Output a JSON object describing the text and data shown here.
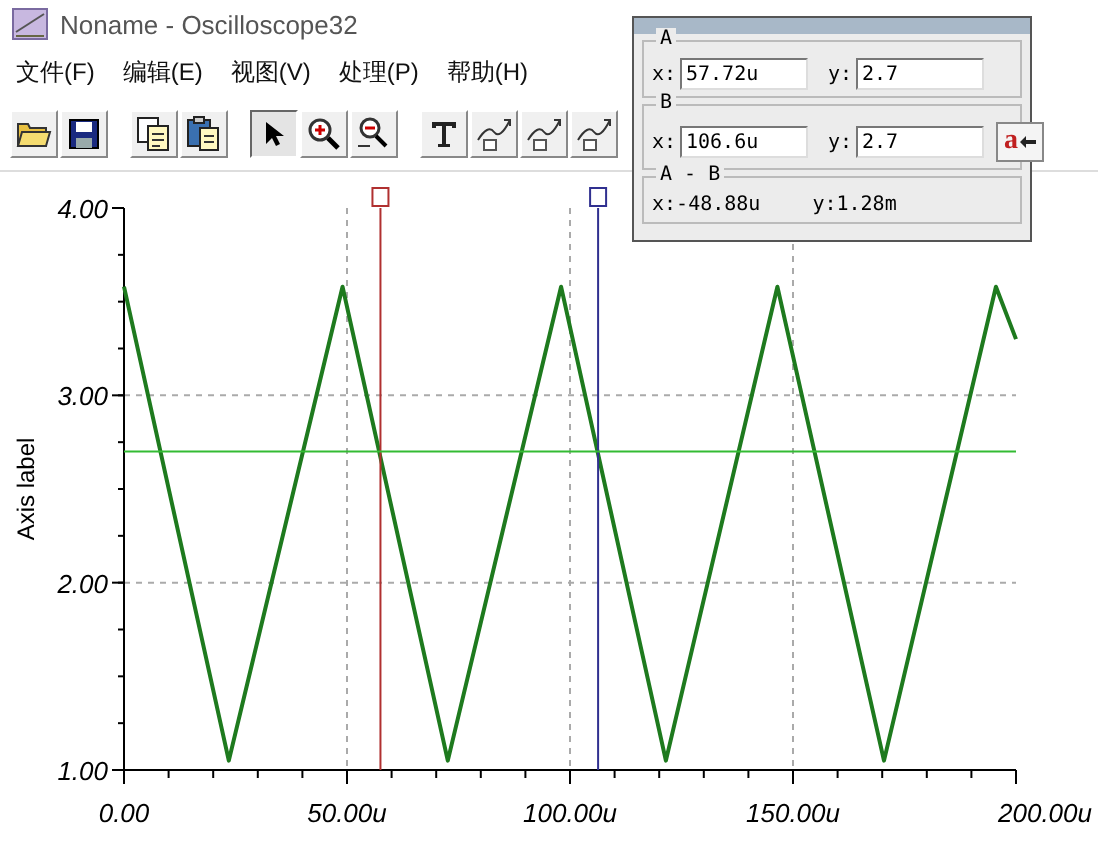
{
  "window": {
    "title": "Noname - Oscilloscope32"
  },
  "menu": [
    {
      "label": "文件(F)"
    },
    {
      "label": "编辑(E)"
    },
    {
      "label": "视图(V)"
    },
    {
      "label": "处理(P)"
    },
    {
      "label": "帮助(H)"
    }
  ],
  "toolbar": [
    {
      "kind": "open",
      "selected": false
    },
    {
      "kind": "save",
      "selected": false
    },
    {
      "kind": "gap"
    },
    {
      "kind": "copy",
      "selected": false
    },
    {
      "kind": "paste",
      "selected": false
    },
    {
      "kind": "gap"
    },
    {
      "kind": "pointer",
      "selected": true
    },
    {
      "kind": "zoom_in",
      "selected": false
    },
    {
      "kind": "zoom_out",
      "selected": false
    },
    {
      "kind": "gap"
    },
    {
      "kind": "text",
      "selected": false
    },
    {
      "kind": "curve",
      "selected": false
    },
    {
      "kind": "curve",
      "selected": false
    },
    {
      "kind": "curve",
      "selected": false
    }
  ],
  "chart_data": {
    "type": "line",
    "ylabel": "Axis label",
    "xlim": [
      0,
      200
    ],
    "ylim": [
      1,
      4
    ],
    "xticks": [
      {
        "value": 0,
        "label": "0.00"
      },
      {
        "value": 50,
        "label": "50.00u"
      },
      {
        "value": 100,
        "label": "100.00u"
      },
      {
        "value": 150,
        "label": "150.00u"
      },
      {
        "value": 200,
        "label": "200.00u"
      }
    ],
    "yticks": [
      {
        "value": 1,
        "label": "1.00"
      },
      {
        "value": 2,
        "label": "2.00"
      },
      {
        "value": 3,
        "label": "3.00"
      },
      {
        "value": 4,
        "label": "4.00"
      }
    ],
    "x": [
      0,
      23.5,
      49,
      72.6,
      98,
      121.5,
      146.5,
      170.4,
      195.5,
      200
    ],
    "grid": true,
    "series": [
      {
        "color": "#1e7a1e",
        "values": [
          3.58,
          1.05,
          3.58,
          1.05,
          3.58,
          1.05,
          3.58,
          1.05,
          3.58,
          3.3
        ]
      }
    ],
    "ref_lines": [
      {
        "axis": "x",
        "value": 57.5,
        "color": "#b03030"
      },
      {
        "axis": "x",
        "value": 106.3,
        "color": "#303090"
      },
      {
        "axis": "y",
        "value": 2.7,
        "color": "#33bb33"
      }
    ]
  },
  "cursor_panel": {
    "groups": [
      {
        "title": "A",
        "fields": [
          {
            "label": "x:",
            "value": "57.72u"
          },
          {
            "label": "y:",
            "value": "2.7"
          }
        ]
      },
      {
        "title": "B",
        "fields": [
          {
            "label": "x:",
            "value": "106.6u"
          },
          {
            "label": "y:",
            "value": "2.7"
          }
        ],
        "button": {
          "label": "a"
        }
      },
      {
        "title": "A - B",
        "readouts": [
          {
            "label": "x:",
            "value": "-48.88u"
          },
          {
            "label": "y:",
            "value": "1.28m"
          }
        ]
      }
    ]
  }
}
